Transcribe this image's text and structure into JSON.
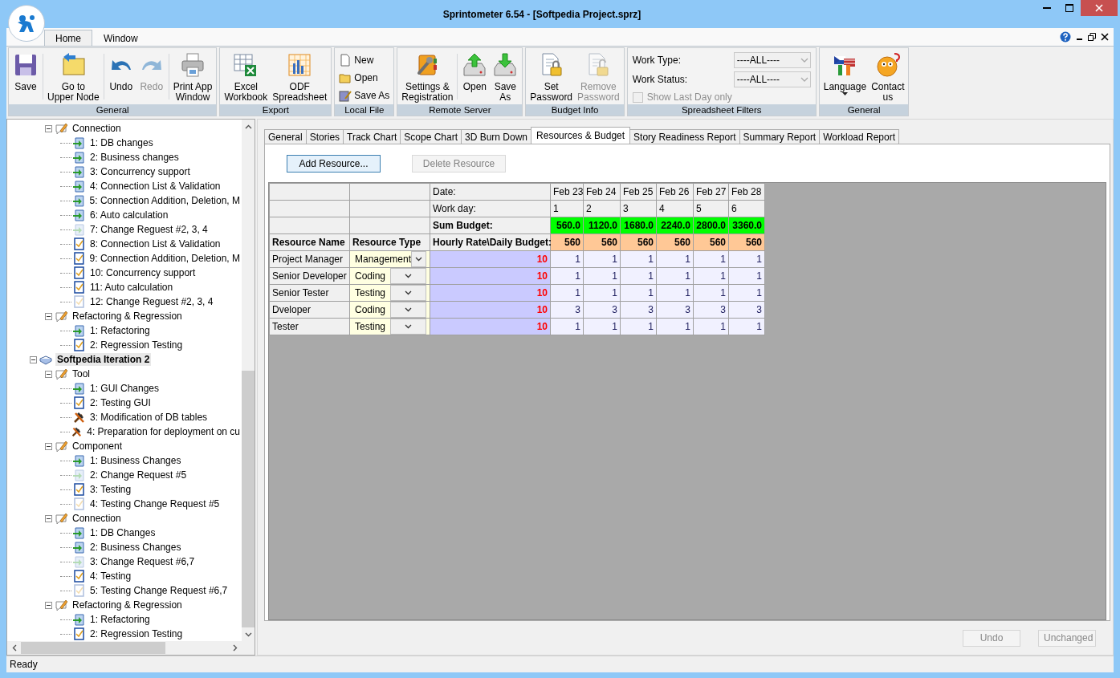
{
  "window": {
    "title": "Sprintometer 6.54 - [Softpedia Project.sprz]"
  },
  "ribbon": {
    "tabs": [
      {
        "label": "Home",
        "selected": true
      },
      {
        "label": "Window",
        "selected": false
      }
    ],
    "groups": [
      {
        "title": "General",
        "kind": "large",
        "buttons": [
          {
            "label": "Save",
            "disabled": false
          },
          {
            "label": "Go to\nUpper Node",
            "disabled": false
          },
          {
            "label": "Undo",
            "disabled": false
          },
          {
            "label": "Redo",
            "disabled": true
          },
          {
            "label": "Print App\nWindow",
            "disabled": false
          }
        ]
      },
      {
        "title": "Export",
        "kind": "large",
        "buttons": [
          {
            "label": "Excel\nWorkbook",
            "disabled": false
          },
          {
            "label": "ODF\nSpreadsheet",
            "disabled": false
          }
        ]
      },
      {
        "title": "Local File",
        "kind": "small",
        "buttons": [
          {
            "label": "New",
            "disabled": false
          },
          {
            "label": "Open",
            "disabled": false
          },
          {
            "label": "Save As",
            "disabled": false
          }
        ]
      },
      {
        "title": "Remote Server",
        "kind": "large",
        "buttons": [
          {
            "label": "Settings &\nRegistration",
            "disabled": false
          },
          {
            "label": "Open",
            "disabled": false
          },
          {
            "label": "Save\nAs",
            "disabled": false
          }
        ]
      },
      {
        "title": "Budget Info",
        "kind": "large",
        "buttons": [
          {
            "label": "Set\nPassword",
            "disabled": false
          },
          {
            "label": "Remove\nPassword",
            "disabled": true
          }
        ]
      },
      {
        "title": "Spreadsheet Filters",
        "kind": "filters",
        "fields": [
          {
            "label": "Work Type:",
            "value": "----ALL----",
            "disabled": true
          },
          {
            "label": "Work Status:",
            "value": "----ALL----",
            "disabled": true
          }
        ],
        "checkbox": {
          "label": "Show Last Day only",
          "checked": false,
          "disabled": true
        }
      },
      {
        "title": "General",
        "kind": "large",
        "buttons": [
          {
            "label": "Language",
            "disabled": false,
            "menu": true
          },
          {
            "label": "Contact\nus",
            "disabled": false
          }
        ]
      }
    ]
  },
  "sidebar": {
    "tree": [
      {
        "children": [
          {
            "label": "Connection",
            "kind": "group",
            "selected": false,
            "children": [
              {
                "label": "1: DB changes",
                "kind": "task",
                "selected": false
              },
              {
                "label": "2: Business changes",
                "kind": "task",
                "selected": false
              },
              {
                "label": "3: Concurrency support",
                "kind": "task",
                "selected": false
              },
              {
                "label": "4: Connection List & Validation",
                "kind": "task",
                "selected": false
              },
              {
                "label": "5: Connection Addition, Deletion, M",
                "kind": "task",
                "selected": false
              },
              {
                "label": "6: Auto calculation",
                "kind": "task",
                "selected": false
              },
              {
                "label": "7: Change Reguest #2, 3, 4",
                "kind": "task-light",
                "selected": false
              },
              {
                "label": "8: Connection List & Validation",
                "kind": "test",
                "selected": false
              },
              {
                "label": "9: Connection Addition, Deletion, M",
                "kind": "test",
                "selected": false
              },
              {
                "label": "10: Concurrency support",
                "kind": "test",
                "selected": false
              },
              {
                "label": "11: Auto calculation",
                "kind": "test",
                "selected": false
              },
              {
                "label": "12: Change Reguest #2, 3, 4",
                "kind": "test-light",
                "selected": false
              }
            ]
          },
          {
            "label": "Refactoring & Regression",
            "kind": "group",
            "selected": false,
            "children": [
              {
                "label": "1: Refactoring",
                "kind": "task",
                "selected": false
              },
              {
                "label": "2: Regression Testing",
                "kind": "test",
                "selected": false
              }
            ]
          }
        ]
      },
      {
        "label": "Softpedia Iteration 2",
        "kind": "iteration",
        "selected": true,
        "children": [
          {
            "label": "Tool",
            "kind": "group",
            "selected": false,
            "children": [
              {
                "label": "1: GUI Changes",
                "kind": "task",
                "selected": false
              },
              {
                "label": "2: Testing GUI",
                "kind": "test",
                "selected": false
              },
              {
                "label": "3: Modification of DB tables",
                "kind": "tool",
                "selected": false
              },
              {
                "label": "4: Preparation for deployment on cu",
                "kind": "tool",
                "selected": false
              }
            ]
          },
          {
            "label": "Component",
            "kind": "group",
            "selected": false,
            "children": [
              {
                "label": "1: Business Changes",
                "kind": "task",
                "selected": false
              },
              {
                "label": "2: Change Request #5",
                "kind": "task-light",
                "selected": false
              },
              {
                "label": "3: Testing",
                "kind": "test",
                "selected": false
              },
              {
                "label": "4: Testing Change Request #5",
                "kind": "test-light",
                "selected": false
              }
            ]
          },
          {
            "label": "Connection",
            "kind": "group",
            "selected": false,
            "children": [
              {
                "label": "1: DB Changes",
                "kind": "task",
                "selected": false
              },
              {
                "label": "2: Business Changes",
                "kind": "task",
                "selected": false
              },
              {
                "label": "3: Change Request #6,7",
                "kind": "task-light",
                "selected": false
              },
              {
                "label": "4: Testing",
                "kind": "test",
                "selected": false
              },
              {
                "label": "5: Testing Change Request #6,7",
                "kind": "test-light",
                "selected": false
              }
            ]
          },
          {
            "label": "Refactoring & Regression",
            "kind": "group",
            "selected": false,
            "children": [
              {
                "label": "1: Refactoring",
                "kind": "task",
                "selected": false
              },
              {
                "label": "2: Regression Testing",
                "kind": "test",
                "selected": false
              }
            ]
          }
        ]
      }
    ]
  },
  "content": {
    "tabs": [
      {
        "label": "General",
        "selected": false
      },
      {
        "label": "Stories",
        "selected": false
      },
      {
        "label": "Track Chart",
        "selected": false
      },
      {
        "label": "Scope Chart",
        "selected": false
      },
      {
        "label": "3D Burn Down",
        "selected": false
      },
      {
        "label": "Resources & Budget",
        "selected": true
      },
      {
        "label": "Story Readiness Report",
        "selected": false
      },
      {
        "label": "Summary Report",
        "selected": false
      },
      {
        "label": "Workload Report",
        "selected": false
      }
    ],
    "buttons": [
      {
        "label": "Add Resource...",
        "disabled": false
      },
      {
        "label": "Delete Resource",
        "disabled": true
      }
    ],
    "grid": {
      "date_label": "Date:",
      "workday_label": "Work day:",
      "sum_label": "Sum Budget:",
      "rate_label": "Hourly Rate\\Daily Budget:",
      "name_header": "Resource Name",
      "type_header": "Resource Type",
      "days": [
        {
          "date": "Feb 23",
          "workday": "1",
          "sum": "560.0",
          "daily": "560"
        },
        {
          "date": "Feb 24",
          "workday": "2",
          "sum": "1120.0",
          "daily": "560"
        },
        {
          "date": "Feb 25",
          "workday": "3",
          "sum": "1680.0",
          "daily": "560"
        },
        {
          "date": "Feb 26",
          "workday": "4",
          "sum": "2240.0",
          "daily": "560"
        },
        {
          "date": "Feb 27",
          "workday": "5",
          "sum": "2800.0",
          "daily": "560"
        },
        {
          "date": "Feb 28",
          "workday": "6",
          "sum": "3360.0",
          "daily": "560"
        }
      ],
      "rows": [
        {
          "name": "Project Manager",
          "type": "Management",
          "rate": "10",
          "hours": [
            "1",
            "1",
            "1",
            "1",
            "1",
            "1"
          ]
        },
        {
          "name": "Senior Developer",
          "type": "Coding",
          "rate": "10",
          "hours": [
            "1",
            "1",
            "1",
            "1",
            "1",
            "1"
          ]
        },
        {
          "name": "Senior Tester",
          "type": "Testing",
          "rate": "10",
          "hours": [
            "1",
            "1",
            "1",
            "1",
            "1",
            "1"
          ]
        },
        {
          "name": "Dveloper",
          "type": "Coding",
          "rate": "10",
          "hours": [
            "3",
            "3",
            "3",
            "3",
            "3",
            "3"
          ]
        },
        {
          "name": "Tester",
          "type": "Testing",
          "rate": "10",
          "hours": [
            "1",
            "1",
            "1",
            "1",
            "1",
            "1"
          ]
        }
      ]
    },
    "footer_buttons": [
      {
        "label": "Undo",
        "disabled": true
      },
      {
        "label": "Unchanged",
        "disabled": true
      }
    ]
  },
  "status_bar": {
    "text": "Ready"
  }
}
